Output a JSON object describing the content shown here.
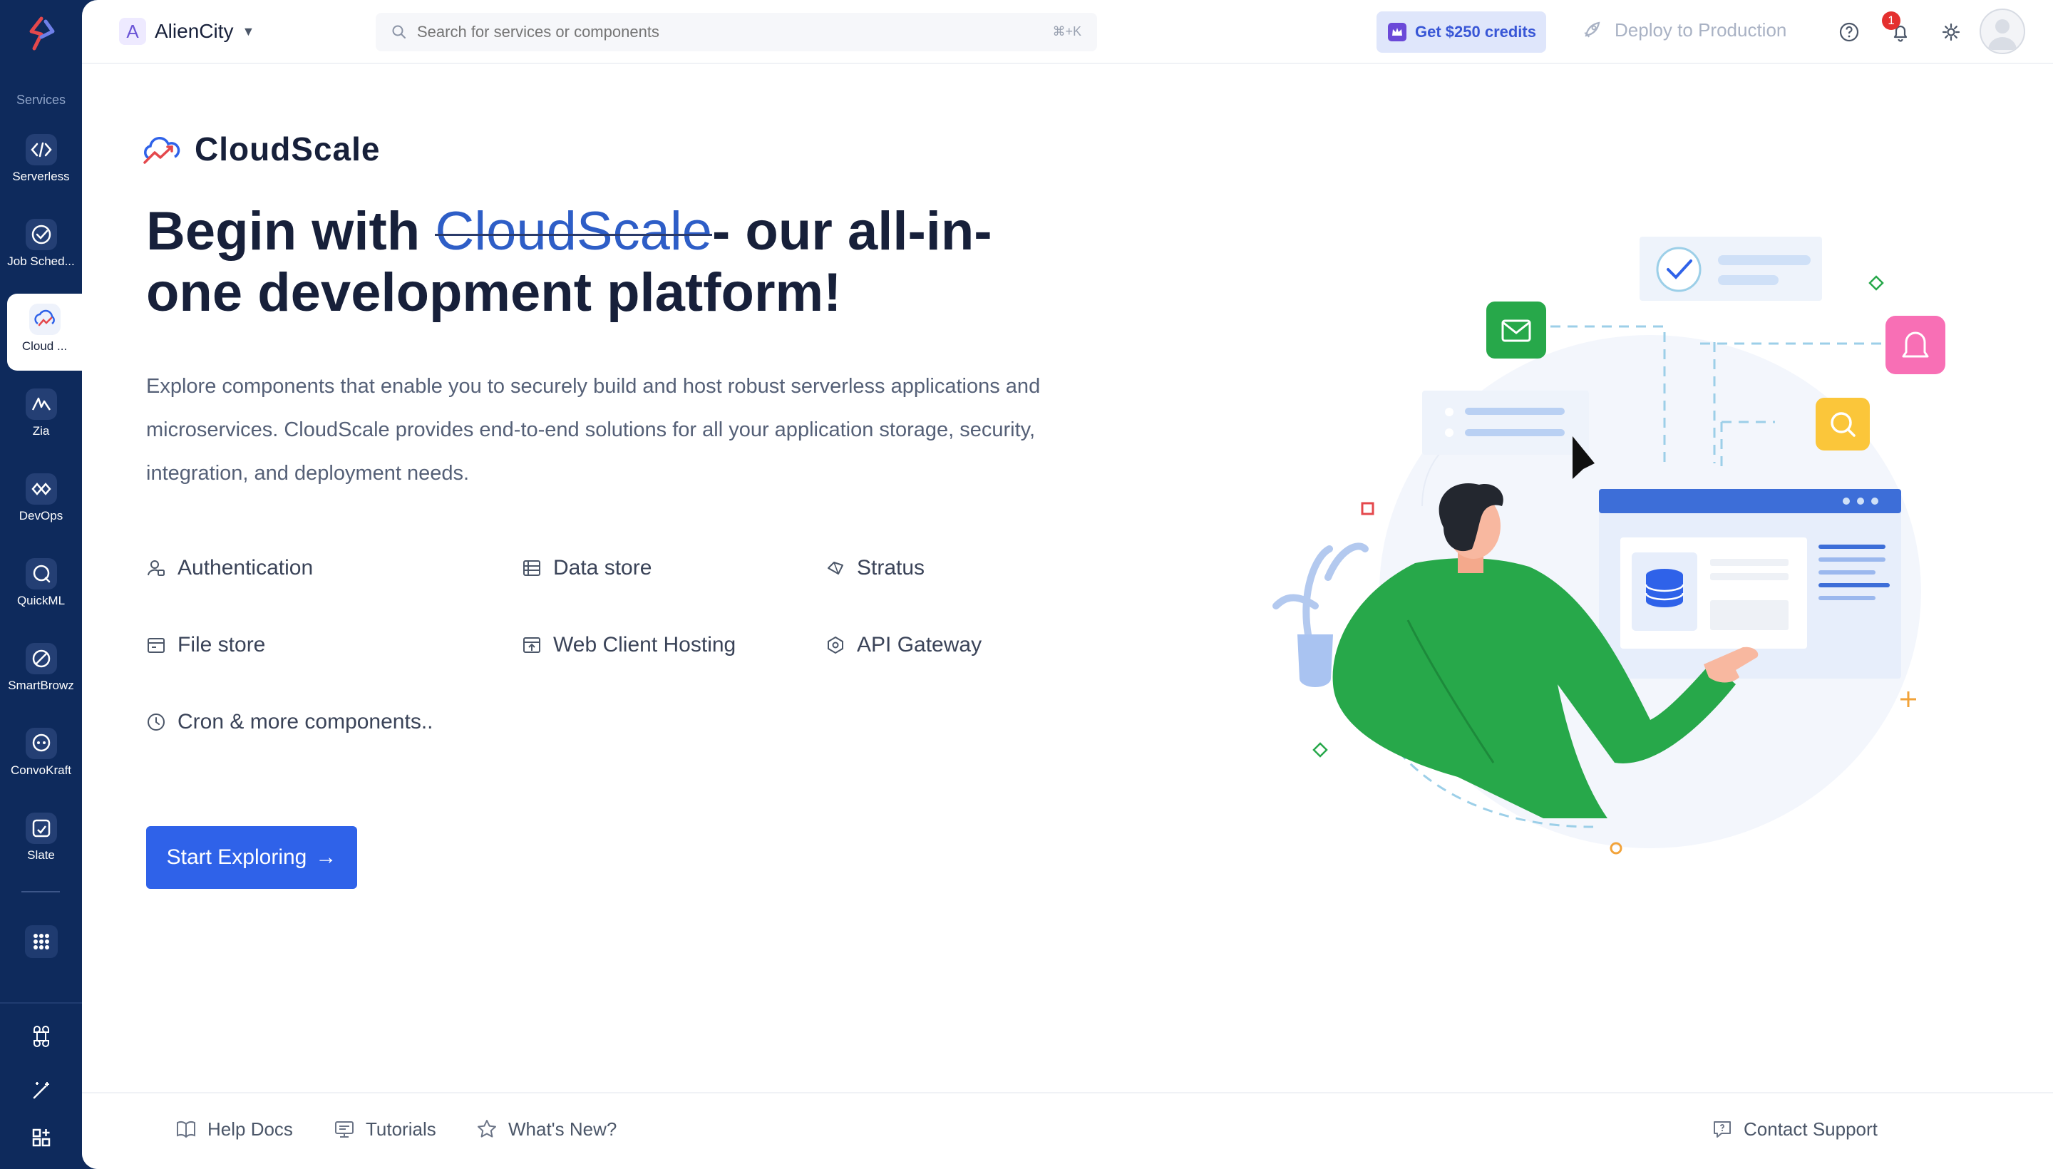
{
  "sidebar": {
    "section_label": "Services",
    "items": [
      {
        "label": "Serverless",
        "icon": "code-brackets-icon"
      },
      {
        "label": "Job Sched...",
        "icon": "job-scheduling-icon"
      },
      {
        "label": "Cloud ...",
        "icon": "cloudscale-icon",
        "active": true
      },
      {
        "label": "Zia",
        "icon": "zia-icon"
      },
      {
        "label": "DevOps",
        "icon": "devops-icon"
      },
      {
        "label": "QuickML",
        "icon": "quickml-icon"
      },
      {
        "label": "SmartBrowz",
        "icon": "smartbrowz-icon"
      },
      {
        "label": "ConvoKraft",
        "icon": "convokraft-icon"
      },
      {
        "label": "Slate",
        "icon": "slate-icon"
      }
    ]
  },
  "topbar": {
    "org_initial": "A",
    "org_name": "AlienCity",
    "search_placeholder": "Search for services or components",
    "search_shortcut": "⌘+K",
    "credits_label": "Get $250 credits",
    "deploy_label": "Deploy to Production",
    "notification_count": "1"
  },
  "main": {
    "brand_name": "CloudScale",
    "headline_pre": "Begin with ",
    "headline_highlight": "CloudScale",
    "headline_post": "- our all-in-one development platform!",
    "description": "Explore components that enable you to securely build and host robust serverless applications and microservices. CloudScale provides end-to-end solutions for all your application storage, security, integration, and deployment needs.",
    "components": [
      {
        "label": "Authentication",
        "icon": "authentication-icon"
      },
      {
        "label": "Data store",
        "icon": "data-store-icon"
      },
      {
        "label": "Stratus",
        "icon": "stratus-icon"
      },
      {
        "label": "File store",
        "icon": "file-store-icon"
      },
      {
        "label": "Web Client Hosting",
        "icon": "web-client-hosting-icon"
      },
      {
        "label": "API Gateway",
        "icon": "api-gateway-icon"
      },
      {
        "label": "Cron & more components..",
        "icon": "clock-icon"
      }
    ],
    "cta_label": "Start Exploring",
    "cta_arrow": "→"
  },
  "footer": {
    "help_docs": "Help Docs",
    "tutorials": "Tutorials",
    "whats_new": "What's New?",
    "contact_support": "Contact Support"
  },
  "colors": {
    "sidebar_bg": "#0e2a5c",
    "primary": "#2f62e9",
    "highlight": "#f7d233",
    "credits_bg": "#dfe6fb"
  }
}
